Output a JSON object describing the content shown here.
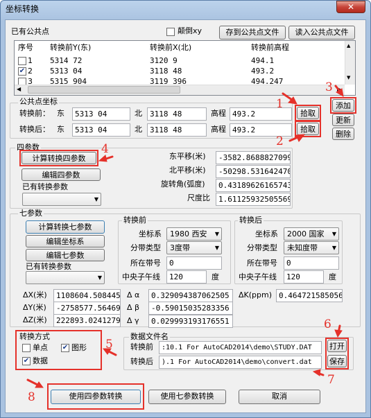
{
  "window": {
    "title": "坐标转换",
    "close": "✕"
  },
  "common_points": {
    "section": "已有公共点",
    "reverse_xy": "颠倒xy",
    "save_btn": "存到公共点文件",
    "load_btn": "读入公共点文件",
    "columns": [
      "序号",
      "转换前Y(东)",
      "转换前X(北)",
      "转换前高程"
    ],
    "rows": [
      {
        "no": "1",
        "y": "5314 72",
        "x": "3120 9",
        "h": "494.1",
        "checked": false
      },
      {
        "no": "2",
        "y": "5313 04",
        "x": "3118 48",
        "h": "493.2",
        "checked": true
      },
      {
        "no": "3",
        "y": "5315 904",
        "x": "3119 396",
        "h": "494.247",
        "checked": false
      }
    ]
  },
  "point_coords": {
    "section": "公共点坐标",
    "before": "转换前：",
    "after": "转换后：",
    "east": "东",
    "north": "北",
    "elev": "高程",
    "before_e": "5313 04",
    "before_n": "3118 48",
    "before_h": "493.2",
    "after_e": "5313 04",
    "after_n": "3118 48",
    "after_h": "493.2",
    "pick1": "拾取",
    "pick2": "拾取",
    "add": "添加",
    "update": "更新",
    "delete": "删除"
  },
  "four": {
    "section": "四参数",
    "calc": "计算转换四参数",
    "edit": "编辑四参数",
    "existing": "已有转换参数",
    "east_label": "东平移(米)",
    "east": "-3582.8688827099",
    "north_label": "北平移(米)",
    "north": "-50298.531642470",
    "rot_label": "旋转角(弧度)",
    "rot": "0.43189626165743",
    "scale_label": "尺度比",
    "scale": "1.61125932505569"
  },
  "seven": {
    "section": "七参数",
    "calc": "计算转换七参数",
    "edit_coord": "编辑坐标系",
    "edit": "编辑七参数",
    "existing": "已有转换参数",
    "before_title": "转换前",
    "after_title": "转换后",
    "coordsys": "坐标系",
    "zone_type": "分带类型",
    "zone_no": "所在带号",
    "meridian": "中央子午线",
    "degree": "度",
    "before_sys": "1980 西安",
    "before_zone": "3度带",
    "before_no": "0",
    "before_mer": "120",
    "after_sys": "2000 国家",
    "after_zone": "未知度带",
    "after_no": "0",
    "after_mer": "120",
    "dx_label": "ΔX(米)",
    "dx": "1108604.508445",
    "dy_label": "ΔY(米)",
    "dy": "-2758577.56469",
    "dz_label": "ΔZ(米)",
    "dz": "222893.0241279",
    "da_label": "Δ α",
    "da": "0.329094387062505",
    "db_label": "Δ β",
    "db": "-0.59015035283356",
    "dg_label": "Δ γ",
    "dg": "0.029993193176551",
    "dk_label": "ΔK(ppm)",
    "dk": "0.464721585056"
  },
  "method": {
    "section": "转换方式",
    "single": "单点",
    "graphic": "图形",
    "data": "数据"
  },
  "files": {
    "section": "数据文件名",
    "before": "转换前",
    "after": "转换后",
    "before_path": ":10.1 For AutoCAD2014\\demo\\STUDY.DAT",
    "after_path": ").1 For AutoCAD2014\\demo\\convert.dat",
    "open": "打开",
    "save": "保存"
  },
  "footer": {
    "use4": "使用四参数转换",
    "use7": "使用七参数转换",
    "cancel": "取消"
  },
  "annotations": [
    "1",
    "2",
    "3",
    "4",
    "5",
    "6",
    "7",
    "8"
  ],
  "colors": {
    "annotation": "#e5312a",
    "titlebar": "#a9c2e0"
  }
}
